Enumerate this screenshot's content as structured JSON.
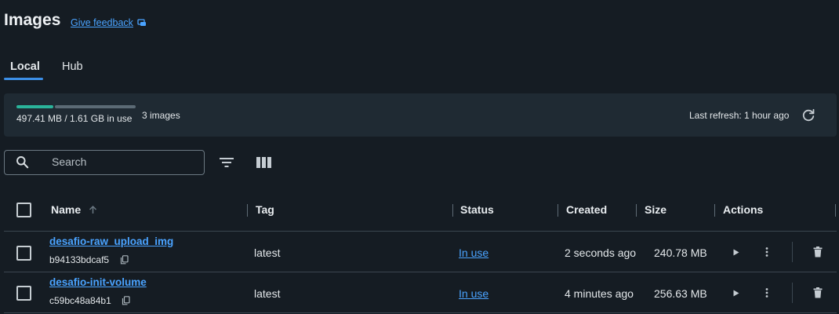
{
  "header": {
    "title": "Images",
    "feedback_label": "Give feedback"
  },
  "tabs": [
    {
      "label": "Local",
      "active": true
    },
    {
      "label": "Hub",
      "active": false
    }
  ],
  "usage": {
    "used_fraction": 0.3,
    "text": "497.41 MB / 1.61 GB in use",
    "count": "3 images",
    "last_refresh": "Last refresh: 1 hour ago"
  },
  "search": {
    "placeholder": "Search",
    "value": ""
  },
  "table": {
    "columns": [
      "Name",
      "Tag",
      "Status",
      "Created",
      "Size",
      "Actions"
    ],
    "rows": [
      {
        "name": "desafio-raw_upload_img",
        "id": "b94133bdcaf5",
        "tag": "latest",
        "status": "In use",
        "created": "2 seconds ago",
        "size": "240.78 MB"
      },
      {
        "name": "desafio-init-volume",
        "id": "c59bc48a84b1",
        "tag": "latest",
        "status": "In use",
        "created": "4 minutes ago",
        "size": "256.63 MB"
      }
    ]
  },
  "colors": {
    "background": "#151c23",
    "panel": "#1f2a33",
    "accent": "#3c8fe8",
    "link": "#4aa3ff",
    "usage_bar": "#2ab39a"
  },
  "icons": [
    "external-feedback-icon",
    "refresh-icon",
    "search-icon",
    "filter-icon",
    "columns-icon",
    "sort-arrow-up-icon",
    "copy-icon",
    "play-icon",
    "kebab-menu-icon",
    "trash-icon"
  ]
}
